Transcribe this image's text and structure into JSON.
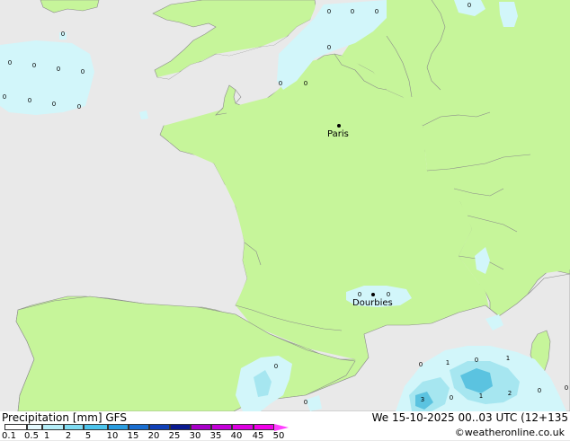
{
  "colors": {
    "sea": "#e9e9e9",
    "land": "#c6f59a",
    "precip_light": "#d2f6fa",
    "precip_mid": "#a6e6f0",
    "precip_heavy": "#5bc3e0"
  },
  "cities": [
    {
      "name": "Paris"
    },
    {
      "name": "Dourbies"
    }
  ],
  "precip_values": [
    "0",
    "0",
    "0",
    "0",
    "0",
    "0",
    "0",
    "0",
    "0",
    "0",
    "0",
    "0",
    "0",
    "0",
    "0",
    "0",
    "0",
    "0",
    "0",
    "0",
    "1",
    "0",
    "1",
    "3",
    "0",
    "1",
    "2",
    "0",
    "0",
    "0",
    "0",
    "0"
  ],
  "footer": {
    "title": "Precipitation [mm] GFS",
    "datetime": "We 15-10-2025 00..03 UTC (12+135",
    "credit": "©weatheronline.co.uk"
  },
  "scale": {
    "ticks": [
      "0.1",
      "0.5",
      "1",
      "2",
      "5",
      "10",
      "15",
      "20",
      "25",
      "30",
      "35",
      "40",
      "45",
      "50"
    ],
    "colors": [
      "#ffffff",
      "#e6fafe",
      "#b5eef8",
      "#7fdcf2",
      "#4cc4ec",
      "#2a9de0",
      "#1a6ed0",
      "#1040b8",
      "#0a1a90",
      "#a800c8",
      "#c400d8",
      "#dc00e0",
      "#f000e8",
      "#ff40ff"
    ]
  }
}
